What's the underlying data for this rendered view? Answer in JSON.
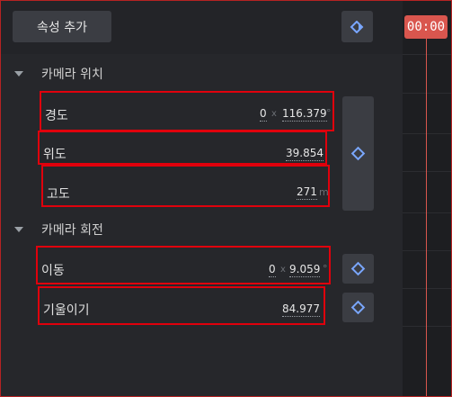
{
  "toolbar": {
    "add_property_label": "속성 추가",
    "keyframe_nav_icon": "next-keyframe-icon",
    "time_display": "00:00"
  },
  "sections": [
    {
      "label": "카메라 위치",
      "properties": [
        {
          "label": "경도",
          "value_x": "0",
          "separator": "x",
          "value": "116.379",
          "unit": "°"
        },
        {
          "label": "위도",
          "value": "39.854"
        },
        {
          "label": "고도",
          "value": "271",
          "unit": "m"
        }
      ]
    },
    {
      "label": "카메라 회전",
      "properties": [
        {
          "label": "이동",
          "value_x": "0",
          "separator": "x",
          "value": "9.059",
          "unit": "°"
        },
        {
          "label": "기울이기",
          "value": "84.977"
        }
      ]
    }
  ],
  "colors": {
    "accent": "#7aa7ff",
    "highlight_border": "#e0000c",
    "time_badge": "#d9564e",
    "panel_bg": "#26272b"
  }
}
